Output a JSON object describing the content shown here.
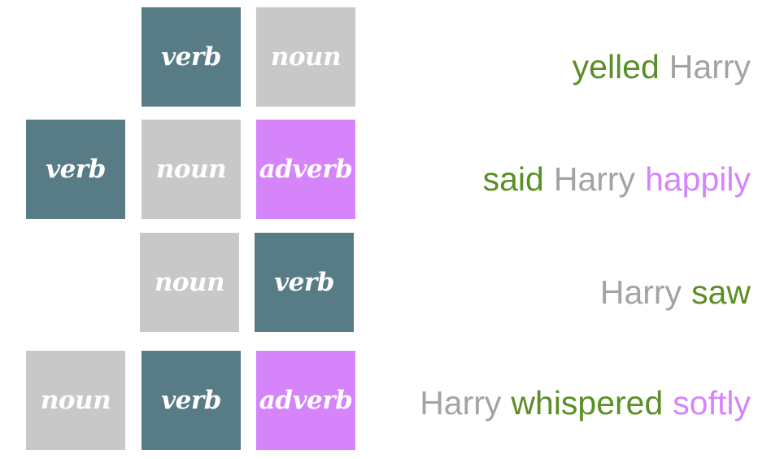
{
  "colors": {
    "verb": "#577c86",
    "noun": "#c8c8c8",
    "adverb": "#d584fa",
    "verb_text": "#5a8f23",
    "noun_text": "#a3a3a3",
    "adverb_text": "#d584fa"
  },
  "tiles": {
    "row1": {
      "verb": "verb",
      "noun": "noun"
    },
    "row2": {
      "verb": "verb",
      "noun": "noun",
      "adverb": "adverb"
    },
    "row3": {
      "noun": "noun",
      "verb": "verb"
    },
    "row4": {
      "noun": "noun",
      "verb": "verb",
      "adverb": "adverb"
    }
  },
  "sentences": {
    "row1": {
      "verb": "yelled",
      "noun": "Harry"
    },
    "row2": {
      "verb": "said",
      "noun": "Harry",
      "adverb": "happily"
    },
    "row3": {
      "noun": "Harry",
      "verb": "saw"
    },
    "row4": {
      "noun": "Harry",
      "verb": "whispered",
      "adverb": "softly"
    }
  }
}
